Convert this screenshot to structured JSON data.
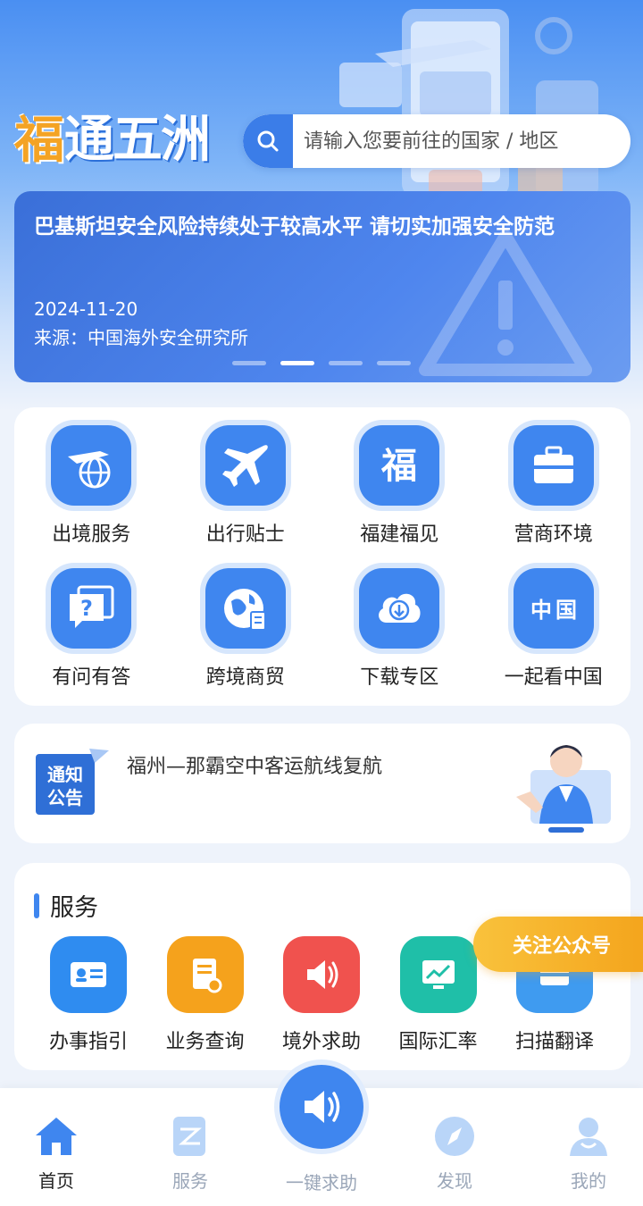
{
  "header": {
    "logo_first": "福",
    "logo_rest": "通五洲",
    "search_placeholder": "请输入您要前往的国家 / 地区"
  },
  "banner": {
    "title": "巴基斯坦安全风险持续处于较高水平 请切实加强安全防范",
    "date": "2024-11-20",
    "source": "来源：中国海外安全研究所",
    "dots": 4,
    "active_dot": 1
  },
  "grid": [
    {
      "label": "出境服务",
      "icon": "plane-globe-icon"
    },
    {
      "label": "出行贴士",
      "icon": "airplane-icon"
    },
    {
      "label": "福建福见",
      "icon": "fu-character-icon"
    },
    {
      "label": "营商环境",
      "icon": "briefcase-icon"
    },
    {
      "label": "有问有答",
      "icon": "question-chat-icon"
    },
    {
      "label": "跨境商贸",
      "icon": "globe-document-icon"
    },
    {
      "label": "下载专区",
      "icon": "cloud-download-icon"
    },
    {
      "label": "一起看中国",
      "icon": "china-characters-icon"
    }
  ],
  "notice": {
    "badge_line1": "通知",
    "badge_line2": "公告",
    "text": "福州—那霸空中客运航线复航"
  },
  "services": {
    "title": "服务",
    "items": [
      {
        "label": "办事指引",
        "icon": "id-card-icon",
        "color": "#2f8cf0"
      },
      {
        "label": "业务查询",
        "icon": "document-search-icon",
        "color": "#f5a21c"
      },
      {
        "label": "境外求助",
        "icon": "speaker-icon",
        "color": "#f0524e"
      },
      {
        "label": "国际汇率",
        "icon": "chart-monitor-icon",
        "color": "#1fbfa8"
      },
      {
        "label": "扫描翻译",
        "icon": "scan-translate-icon",
        "color": "#3f9bf0"
      }
    ]
  },
  "follow_button": "关注公众号",
  "tabbar": {
    "home": "首页",
    "services": "服务",
    "sos": "一键求助",
    "discover": "发现",
    "mine": "我的"
  },
  "colors": {
    "primary": "#3f86ef",
    "accent_orange": "#f4a324",
    "background": "#eef3fb"
  }
}
